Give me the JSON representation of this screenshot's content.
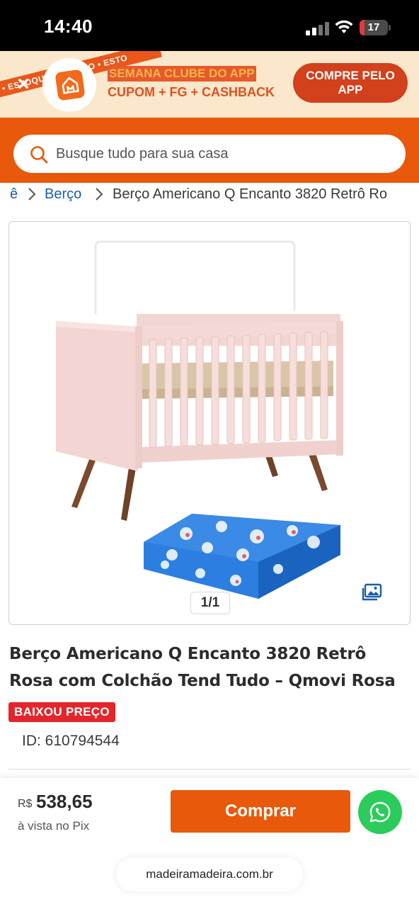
{
  "status_bar": {
    "time": "14:40",
    "battery": "17"
  },
  "promo": {
    "ribbon_text": "• ESTOQUE LIMITADO • ESTO",
    "line1": "SEMANA CLUBE DO APP",
    "line2": "CUPOM + FG + CASHBACK",
    "cta_label": "COMPRE PELO APP"
  },
  "search": {
    "placeholder": "Busque tudo para sua casa"
  },
  "breadcrumb": {
    "items": [
      "ê",
      "Berço",
      "Berço Americano Q Encanto 3820 Retrô Ro"
    ]
  },
  "gallery": {
    "counter": "1/1"
  },
  "product": {
    "title": "Berço Americano Q Encanto 3820 Retrô Rosa com Colchão Tend Tudo – Qmovi Rosa",
    "badge": "BAIXOU PREÇO",
    "id_text": "ID: 610794544"
  },
  "purchase": {
    "currency": "R$",
    "price": "538,65",
    "price_note": "à vista no Pix",
    "buy_label": "Comprar"
  },
  "browser": {
    "url": "madeiramadeira.com.br"
  },
  "colors": {
    "brand_orange": "#e8590c",
    "link_blue": "#1a5ea8",
    "badge_red": "#e3262c",
    "whatsapp_green": "#2bcc5b"
  }
}
